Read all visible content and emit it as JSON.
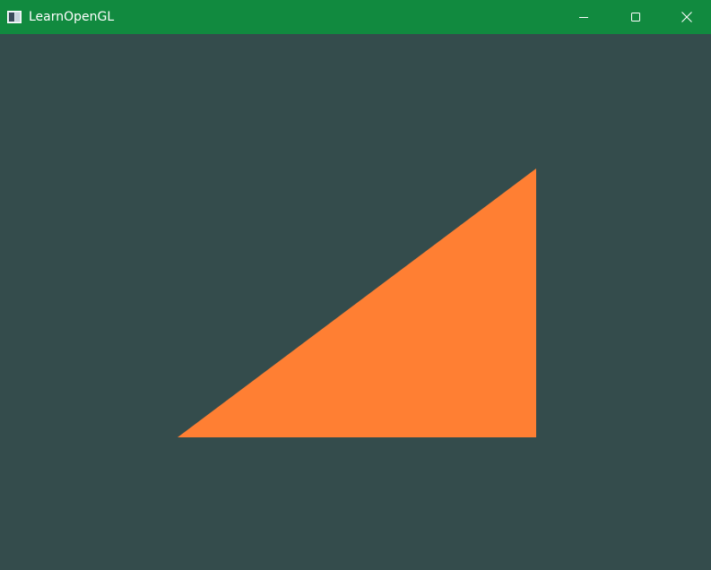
{
  "window": {
    "title": "LearnOpenGL",
    "titlebar_color": "#118a3f",
    "icons": {
      "app": "app-window-icon",
      "minimize": "minimize-icon",
      "maximize": "maximize-icon",
      "close": "close-icon"
    }
  },
  "scene": {
    "clear_color": "#344c4c",
    "triangle": {
      "color": "#ff7f33",
      "shape": "right-triangle"
    }
  }
}
